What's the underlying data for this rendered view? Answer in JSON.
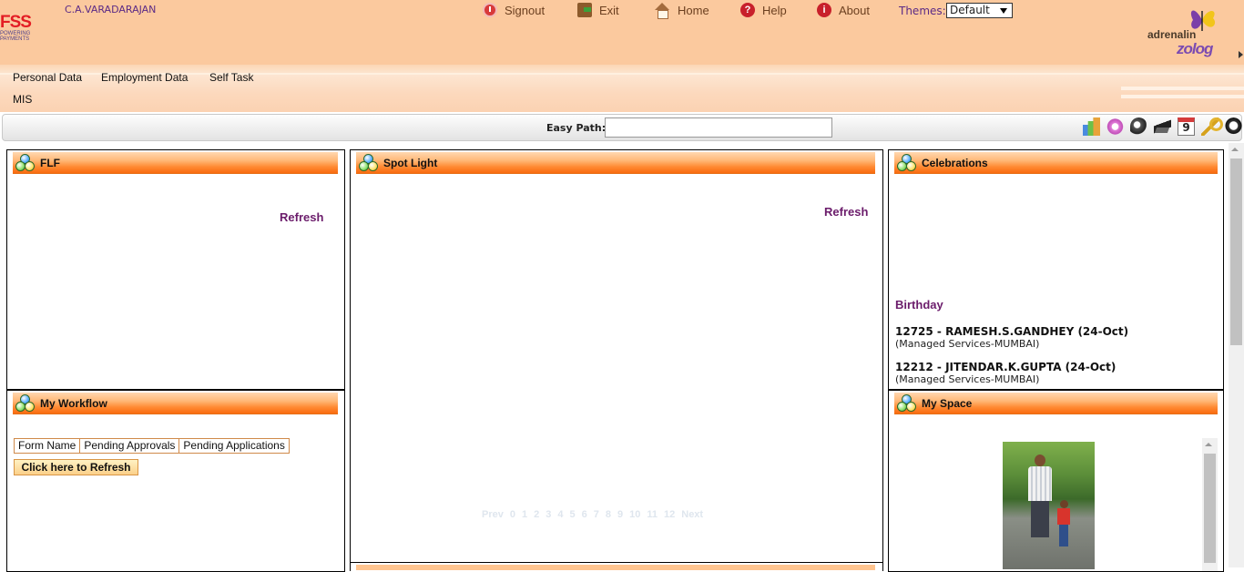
{
  "header": {
    "logo_text": "FSS",
    "logo_tagline_1": "POWERING",
    "logo_tagline_2": "PAYMENTS",
    "username": "C.A.VARADARAJAN",
    "nav": {
      "signout": "Signout",
      "exit": "Exit",
      "home": "Home",
      "help": "Help",
      "about": "About"
    },
    "themes_label": "Themes:",
    "themes_value": "Default",
    "brand_1": "adrenalin",
    "brand_2": "zolog"
  },
  "menu": {
    "personal_data": "Personal Data",
    "employment_data": "Employment Data",
    "self_task": "Self Task",
    "mis": "MIS"
  },
  "pathbar": {
    "label": "Easy Path:",
    "value": "",
    "calendar_day": "9"
  },
  "panels": {
    "flf": {
      "title": "FLF",
      "refresh": "Refresh"
    },
    "spotlight": {
      "title": "Spot Light",
      "refresh": "Refresh",
      "pager": [
        "Prev",
        "0",
        "1",
        "2",
        "3",
        "4",
        "5",
        "6",
        "7",
        "8",
        "9",
        "10",
        "11",
        "12",
        "Next"
      ]
    },
    "celebrations": {
      "title": "Celebrations",
      "section": "Birthday",
      "entries": [
        {
          "name": "12725 - RAMESH.S.GANDHEY (24-Oct)",
          "dept": "(Managed Services-MUMBAI)"
        },
        {
          "name": "12212 - JITENDAR.K.GUPTA (24-Oct)",
          "dept": "(Managed Services-MUMBAI)"
        }
      ]
    },
    "workflow": {
      "title": "My Workflow",
      "columns": [
        "Form Name",
        "Pending Approvals",
        "Pending Applications"
      ],
      "refresh_button": "Click here to Refresh"
    },
    "myspace": {
      "title": "My Space"
    }
  },
  "colors": {
    "header_bg": "#fbc99e",
    "panel_title_orange": "#f96b0f",
    "link_purple": "#6b1c6b"
  }
}
